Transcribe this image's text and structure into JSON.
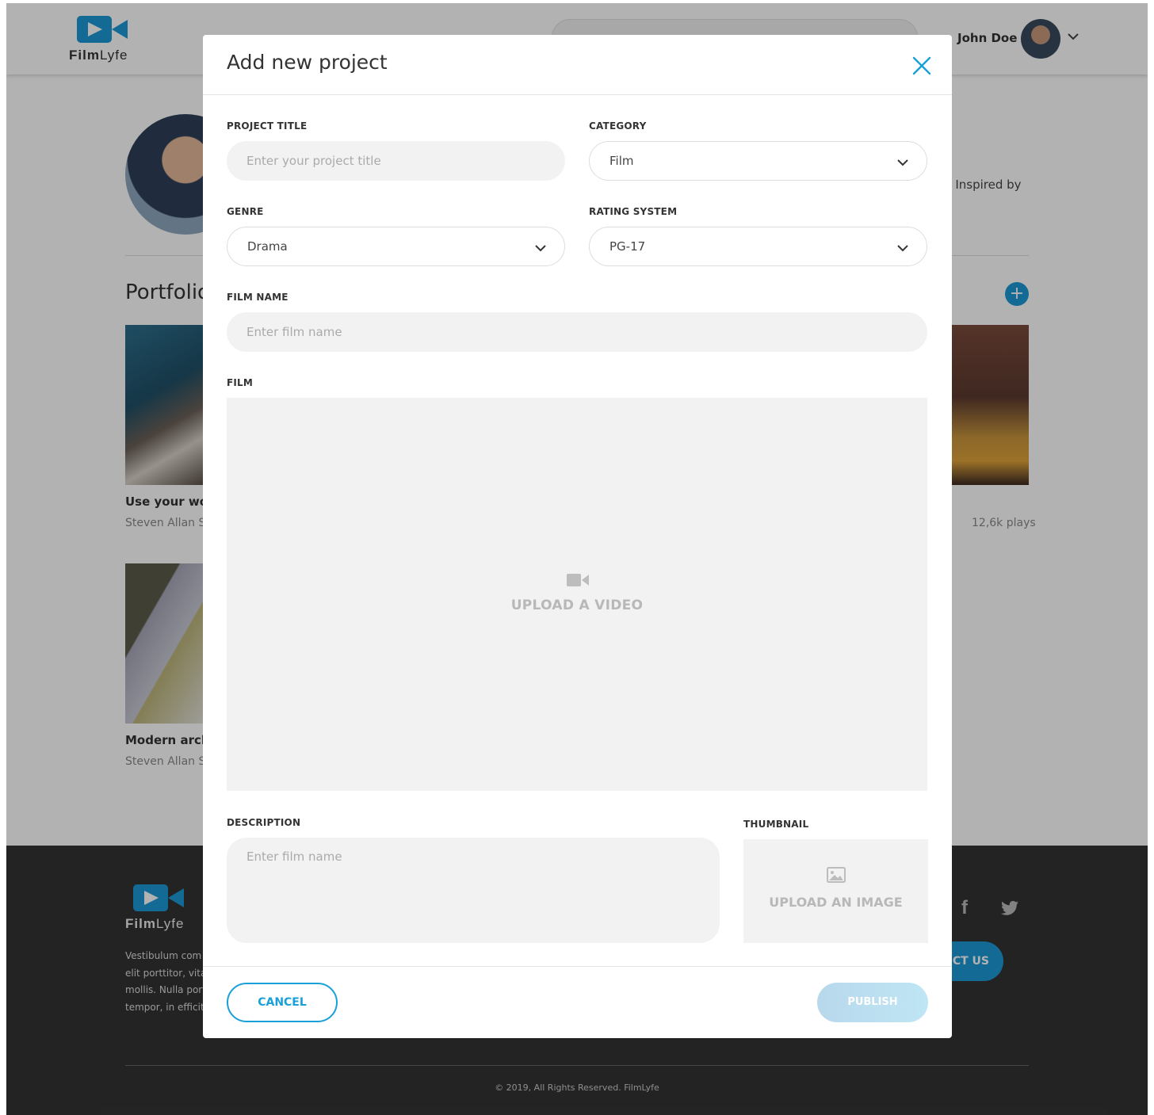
{
  "background": {
    "logo": {
      "brand_bold": "Film",
      "brand_rest": "Lyfe"
    },
    "user": {
      "name": "John Doe"
    },
    "profile": {
      "bio_fragment": "s. Inspired by"
    },
    "portfolio": {
      "title": "Portfolio",
      "cards": [
        {
          "title": "Use your wolf",
          "author": "Steven Allan S"
        },
        {
          "title": "Modern arch",
          "author": "Steven Allan S"
        }
      ],
      "right_card_plays": "12,6k plays"
    },
    "footer": {
      "description": [
        "Vestibulum com",
        "elit porttitor, vita",
        "mollis. Nulla port",
        "tempor, in efficit"
      ],
      "contact_label": "CT US",
      "copyright": "© 2019, All Rights Reserved. FilmLyfe"
    }
  },
  "modal": {
    "title": "Add new project",
    "fields": {
      "project_title": {
        "label": "PROJECT TITLE",
        "placeholder": "Enter your project title",
        "value": ""
      },
      "category": {
        "label": "CATEGORY",
        "value": "Film"
      },
      "genre": {
        "label": "GENRE",
        "value": "Drama"
      },
      "rating_system": {
        "label": "RATING SYSTEM",
        "value": "PG-17"
      },
      "film_name": {
        "label": "FILM NAME",
        "placeholder": "Enter film name",
        "value": ""
      },
      "film": {
        "label": "FILM",
        "upload_text": "UPLOAD A VIDEO"
      },
      "description": {
        "label": "DESCRIPTION",
        "placeholder": "Enter film name",
        "value": ""
      },
      "thumbnail": {
        "label": "THUMBNAIL",
        "upload_text": "UPLOAD AN IMAGE"
      }
    },
    "buttons": {
      "cancel": "CANCEL",
      "publish": "PUBLISH"
    }
  },
  "colors": {
    "accent": "#1aa0d8",
    "brand_blue": "#1c9ad6",
    "input_bg": "#f2f2f2",
    "footer_bg": "#333333",
    "publish_disabled": "#b8d8ec"
  },
  "icons": {
    "close": "close-icon",
    "chevron": "chevron-down-icon",
    "video": "video-camera-icon",
    "image": "image-icon",
    "facebook": "facebook-icon",
    "twitter": "twitter-icon",
    "logo": "camera-logo-icon"
  }
}
